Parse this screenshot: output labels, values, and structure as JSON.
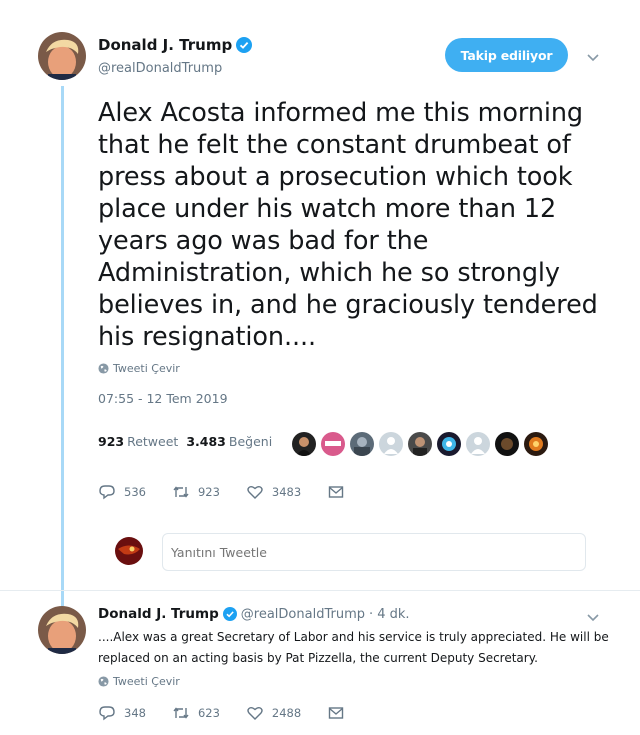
{
  "main_tweet": {
    "display_name": "Donald J. Trump",
    "handle": "@realDonaldTrump",
    "follow_button_label": "Takip ediliyor",
    "text": "Alex Acosta informed me this morning\nthat he felt the constant drumbeat of\npress about a prosecution which took\nplace under his watch more than 12\nyears ago was bad for the\nAdministration, which he so strongly\nbelieves in, and he graciously tendered\nhis resignation....",
    "translate_label": "Tweeti Çevir",
    "timestamp": "07:55 - 12 Tem 2019",
    "retweet_count": "923",
    "retweet_label": "Retweet",
    "like_count": "3.483",
    "like_label": "Beğeni",
    "actions": {
      "reply_count": "536",
      "retweet_count": "923",
      "like_count": "3483"
    }
  },
  "reply_composer": {
    "placeholder": "Yanıtını Tweetle"
  },
  "second_tweet": {
    "display_name": "Donald J. Trump",
    "handle": "@realDonaldTrump",
    "time_ago": "· 4 dk.",
    "text": "....Alex was a great Secretary of Labor and his service is truly appreciated. He will be replaced on an acting basis by Pat Pizzella, the current Deputy Secretary.",
    "translate_label": "Tweeti Çevir",
    "actions": {
      "reply_count": "348",
      "retweet_count": "623",
      "like_count": "2488"
    }
  },
  "colors": {
    "accent": "#1da1f2",
    "follow_button": "#3faff2",
    "thread_line": "#a8d9f7",
    "secondary_text": "#657786"
  },
  "icons": [
    "verified-badge-icon",
    "chevron-down-icon",
    "globe-icon",
    "reply-icon",
    "retweet-icon",
    "like-icon",
    "message-icon"
  ]
}
